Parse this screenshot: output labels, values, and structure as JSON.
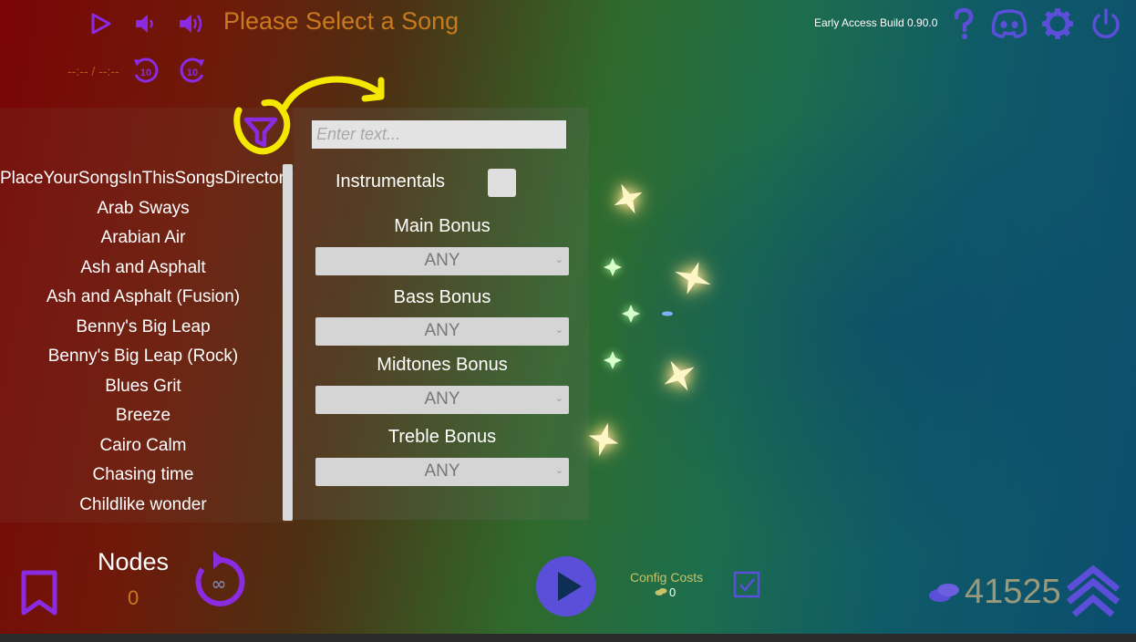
{
  "header": {
    "song_title": "Please Select a Song",
    "time": "--:-- / --:--",
    "build": "Early Access Build 0.90.0",
    "skip_back_label": "10",
    "skip_forward_label": "10"
  },
  "filter": {
    "search_placeholder": "Enter text...",
    "instrumentals_label": "Instrumentals",
    "instrumentals_checked": false,
    "bonuses": [
      {
        "label": "Main Bonus",
        "value": "ANY"
      },
      {
        "label": "Bass Bonus",
        "value": "ANY"
      },
      {
        "label": "Midtones Bonus",
        "value": "ANY"
      },
      {
        "label": "Treble Bonus",
        "value": "ANY"
      }
    ]
  },
  "songs": [
    "PlaceYourSongsInThisSongsDirectory",
    "Arab Sways",
    "Arabian Air",
    "Ash and Asphalt",
    "Ash and Asphalt (Fusion)",
    "Benny's Big Leap",
    "Benny's Big Leap (Rock)",
    "Blues Grit",
    "Breeze",
    "Cairo Calm",
    "Chasing time",
    "Childlike wonder"
  ],
  "footer": {
    "nodes_title": "Nodes",
    "nodes_value": "0",
    "config_costs_label": "Config Costs",
    "config_costs_value": "0",
    "coins": "41525"
  },
  "colors": {
    "accent_purple": "#8a2be2",
    "icon_blue": "#5b4fd9",
    "highlight_yellow": "#f5e800",
    "orange_text": "#c97a1e"
  },
  "icons": {
    "play": "play-icon",
    "volume_low": "volume-low-icon",
    "volume_high": "volume-high-icon",
    "help": "help-icon",
    "discord": "discord-icon",
    "settings": "gear-icon",
    "power": "power-icon",
    "filter": "filter-icon",
    "bookmark": "bookmark-icon",
    "loop": "infinite-loop-icon",
    "config_check": "checkbox-icon",
    "coins": "coins-icon",
    "upgrade": "upgrade-chevrons-icon"
  }
}
